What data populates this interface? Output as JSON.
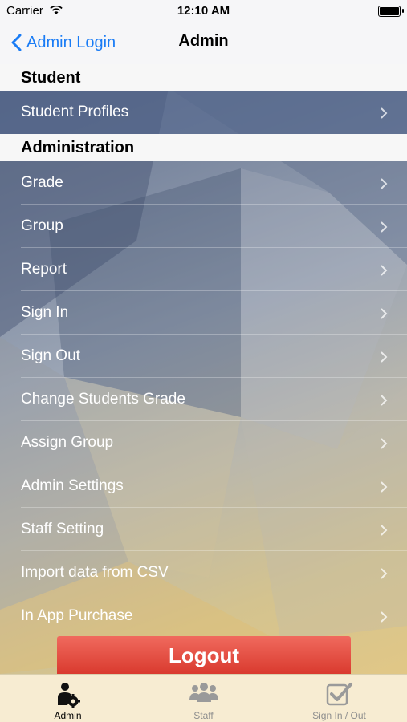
{
  "status_bar": {
    "carrier": "Carrier",
    "time": "12:10 AM"
  },
  "nav": {
    "back_label": "Admin Login",
    "title": "Admin"
  },
  "sections": [
    {
      "header": "Student",
      "items": [
        {
          "label": "Student Profiles",
          "selected": true
        }
      ]
    },
    {
      "header": "Administration",
      "items": [
        {
          "label": "Grade"
        },
        {
          "label": "Group"
        },
        {
          "label": "Report"
        },
        {
          "label": "Sign In"
        },
        {
          "label": "Sign Out"
        },
        {
          "label": "Change Students Grade"
        },
        {
          "label": "Assign Group"
        },
        {
          "label": "Admin Settings"
        },
        {
          "label": "Staff Setting"
        },
        {
          "label": "Import data from CSV"
        },
        {
          "label": "In App Purchase"
        }
      ]
    }
  ],
  "logout_label": "Logout",
  "tab_bar": {
    "tabs": [
      {
        "label": "Admin",
        "icon": "admin-gear-person-icon",
        "active": true
      },
      {
        "label": "Staff",
        "icon": "group-people-icon",
        "active": false
      },
      {
        "label": "Sign In / Out",
        "icon": "checkbox-check-icon",
        "active": false
      }
    ]
  },
  "colors": {
    "accent": "#1a7cf5",
    "logout": "#e3463b",
    "tab_bar_bg": "#f7ecd2"
  }
}
